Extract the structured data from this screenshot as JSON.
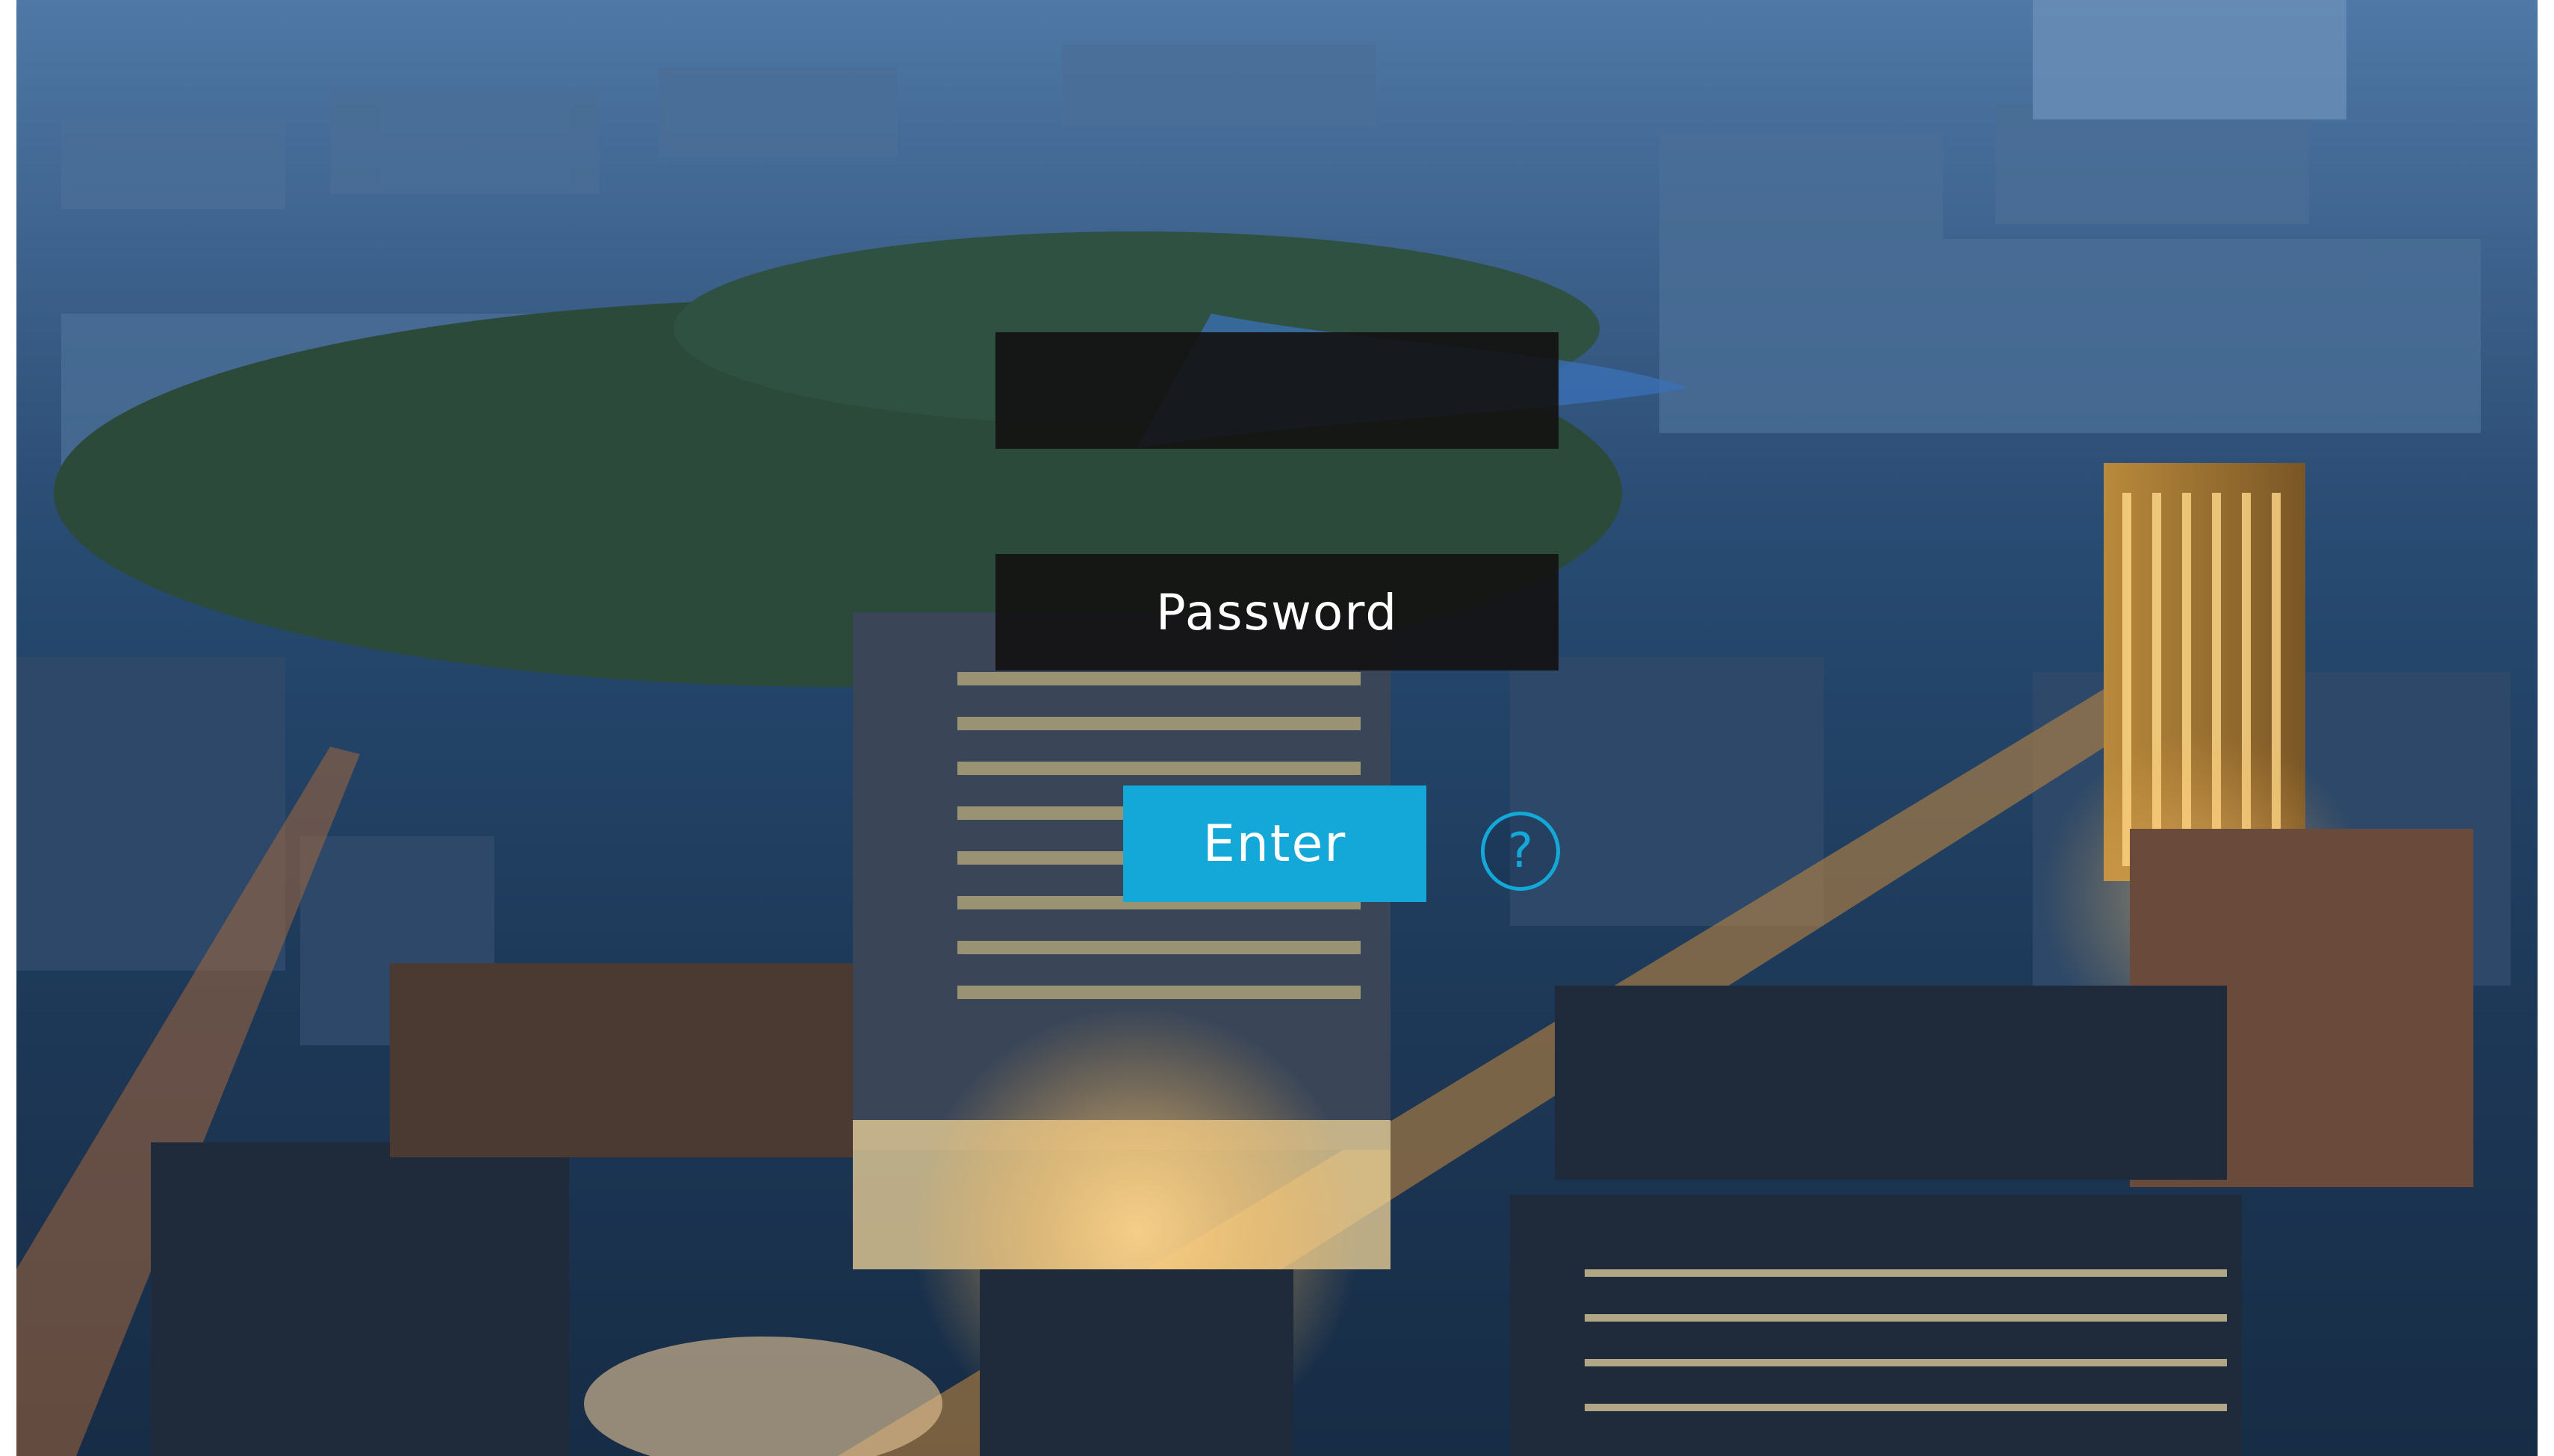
{
  "login": {
    "username_placeholder": "",
    "password_placeholder": "Password",
    "enter_label": "Enter",
    "help_label": "?"
  },
  "colors": {
    "accent": "#14a8d8",
    "field_background": "#141212",
    "text": "#ffffff"
  },
  "icons": {
    "help": "question-circle-icon"
  }
}
